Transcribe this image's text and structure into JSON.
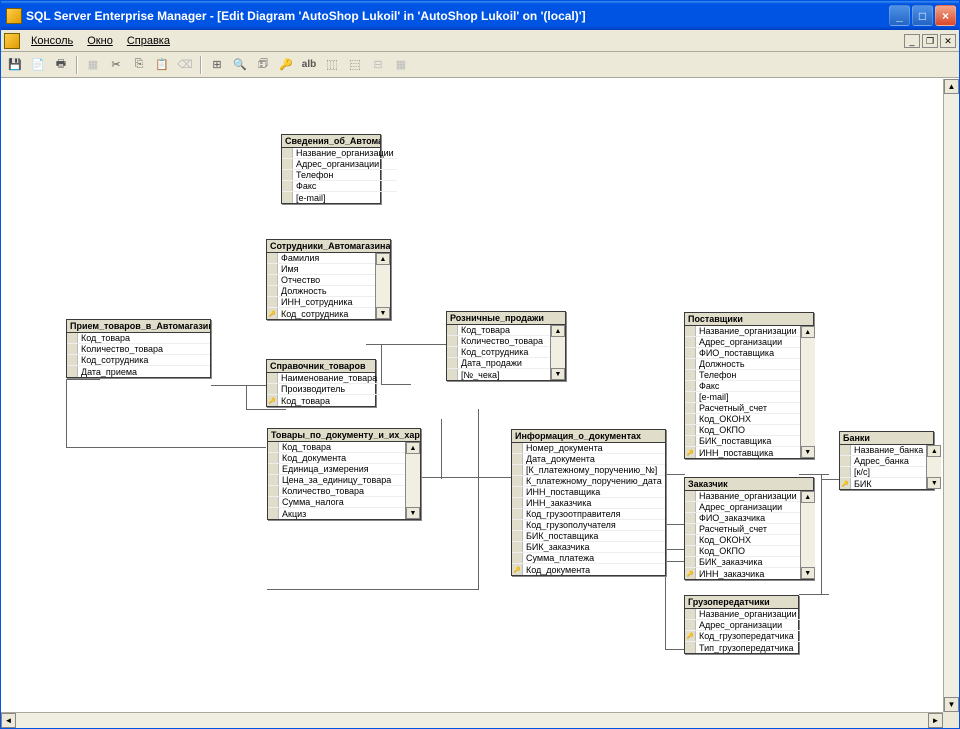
{
  "window": {
    "title": "SQL Server Enterprise Manager - [Edit Diagram 'AutoShop Lukoil' in 'AutoShop Lukoil' on '(local)']"
  },
  "menu": {
    "console": "Консоль",
    "window": "Окно",
    "help": "Справка"
  },
  "toolbar": {
    "zoom_text": "alb"
  },
  "tables": {
    "svedeniya": {
      "title": "Сведения_об_Автомага:",
      "rows": [
        "Название_организации",
        "Адрес_организации",
        "Телефон",
        "Факс",
        "[e-mail]"
      ]
    },
    "sotrudniki": {
      "title": "Сотрудники_Автомагазина",
      "rows": [
        "Фамилия",
        "Имя",
        "Отчество",
        "Должность",
        "ИНН_сотрудника",
        "Код_сотрудника"
      ],
      "key_index": 5
    },
    "priem": {
      "title": "Прием_товаров_в_Автомагазин",
      "rows": [
        "Код_товара",
        "Количество_товара",
        "Код_сотрудника",
        "Дата_приема"
      ]
    },
    "spravochnik": {
      "title": "Справочник_товаров",
      "rows": [
        "Наименование_товара",
        "Производитель",
        "Код_товара"
      ],
      "key_index": 2
    },
    "roznica": {
      "title": "Розничные_продажи",
      "rows": [
        "Код_товара",
        "Количество_товара",
        "Код_сотрудника",
        "Дата_продажи",
        "[№_чека]"
      ]
    },
    "tovary_doc": {
      "title": "Товары_по_документу_и_их_хар:",
      "rows": [
        "Код_товара",
        "Код_документа",
        "Единица_измерения",
        "Цена_за_единицу_товара",
        "Количество_товара",
        "Сумма_налога",
        "Акциз"
      ]
    },
    "info_doc": {
      "title": "Информация_о_документах",
      "rows": [
        "Номер_документа",
        "Дата_документа",
        "[К_платежному_поручению_№]",
        "К_платежному_поручению_дата",
        "ИНН_поставщика",
        "ИНН_заказчика",
        "Код_грузоотправителя",
        "Код_грузополучателя",
        "БИК_поставщика",
        "БИК_заказчика",
        "Сумма_платежа",
        "Код_документа"
      ],
      "key_index": 11
    },
    "postavshiki": {
      "title": "Поставщики",
      "rows": [
        "Название_организации",
        "Адрес_организации",
        "ФИО_поставщика",
        "Должность",
        "Телефон",
        "Факс",
        "[e-mail]",
        "Расчетный_счет",
        "Код_ОКОНХ",
        "Код_ОКПО",
        "БИК_поставщика",
        "ИНН_поставщика"
      ],
      "key_index": 11
    },
    "zakazchik": {
      "title": "Заказчик",
      "rows": [
        "Название_организации",
        "Адрес_организации",
        "ФИО_заказчика",
        "Расчетный_счет",
        "Код_ОКОНХ",
        "Код_ОКПО",
        "БИК_заказчика",
        "ИНН_заказчика"
      ],
      "key_index": 7
    },
    "gruzo": {
      "title": "Грузопередатчики",
      "rows": [
        "Название_организации",
        "Адрес_организации",
        "Код_грузопередатчика",
        "Тип_грузопередатчика"
      ],
      "key_index": 2
    },
    "banki": {
      "title": "Банки",
      "rows": [
        "Название_банка",
        "Адрес_банка",
        "[к/с]",
        "БИК"
      ],
      "key_index": 3
    }
  }
}
